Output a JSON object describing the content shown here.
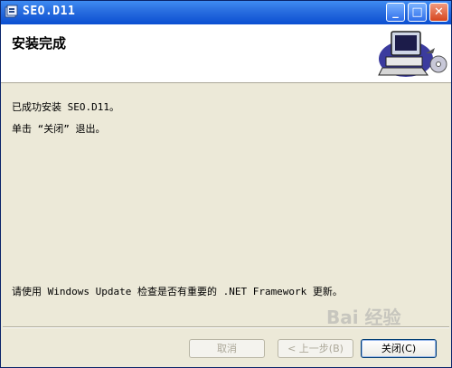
{
  "window": {
    "title": "SEO.D11",
    "controls": {
      "minimize": "_",
      "maximize": "□",
      "close": "✕"
    }
  },
  "header": {
    "heading": "安装完成",
    "graphic_icon": "computer-install-icon"
  },
  "content": {
    "line1": "已成功安装 SEO.D11。",
    "line2": "单击 “关闭” 退出。",
    "line3": "请使用 Windows Update 检查是否有重要的 .NET Framework 更新。"
  },
  "buttons": {
    "cancel": "取消",
    "previous": "< 上一步(B)",
    "close": "关闭(C)"
  },
  "watermark": {
    "text": "Bai 经验",
    "icon": "paw-icon"
  },
  "colors": {
    "titlebar": "#0b4fd1",
    "window_bg": "#ece9d8",
    "close_btn": "#d6461e"
  }
}
